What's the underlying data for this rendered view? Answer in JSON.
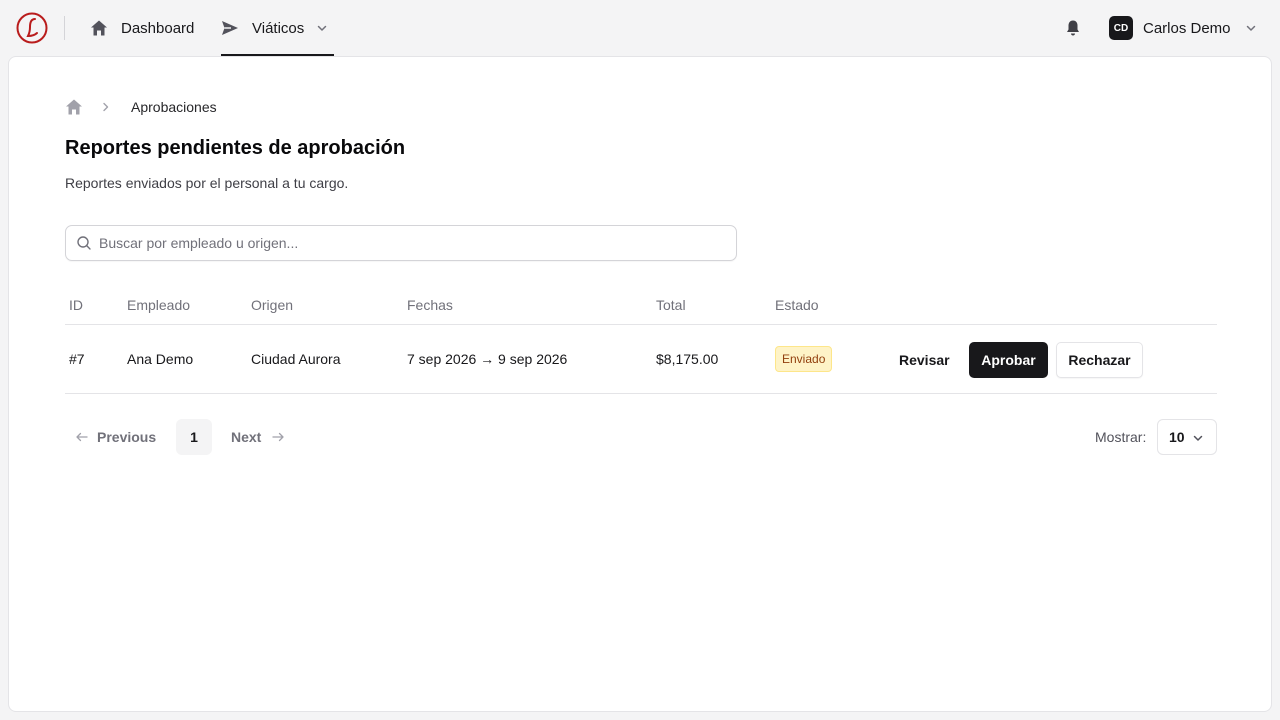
{
  "nav": {
    "dashboard_label": "Dashboard",
    "viaticos_label": "Viáticos",
    "user_initials": "CD",
    "user_name": "Carlos Demo"
  },
  "breadcrumb": {
    "current": "Aprobaciones"
  },
  "page": {
    "title": "Reportes pendientes de aprobación",
    "subtitle": "Reportes enviados por el personal a tu cargo."
  },
  "search": {
    "placeholder": "Buscar por empleado u origen..."
  },
  "table": {
    "headers": {
      "id": "ID",
      "employee": "Empleado",
      "origin": "Origen",
      "dates": "Fechas",
      "total": "Total",
      "status": "Estado"
    },
    "rows": [
      {
        "id": "#7",
        "employee": "Ana Demo",
        "origin": "Ciudad Aurora",
        "dates": "7 sep 2026 → 9 sep 2026",
        "total": "$8,175.00",
        "status": "Enviado",
        "review_label": "Revisar",
        "approve_label": "Aprobar",
        "reject_label": "Rechazar"
      }
    ]
  },
  "pagination": {
    "previous_label": "Previous",
    "current_page": "1",
    "next_label": "Next",
    "show_label": "Mostrar:",
    "page_size": "10"
  },
  "colors": {
    "accent": "#18181b",
    "logo": "#b91c1c",
    "badge_bg": "#fef3c7",
    "badge_text": "#92400e"
  }
}
